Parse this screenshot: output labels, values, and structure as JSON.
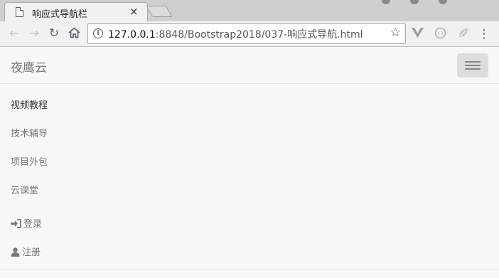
{
  "browser": {
    "tab_title": "响应式导航栏",
    "tab_close": "×",
    "url_host": "127.0.0.1",
    "url_rest": ":8848/Bootstrap2018/037-响应式导航.html"
  },
  "navbar": {
    "brand": "夜鹰云",
    "links": [
      {
        "label": "视频教程",
        "active": true
      },
      {
        "label": "技术辅导",
        "active": false
      },
      {
        "label": "项目外包",
        "active": false
      },
      {
        "label": "云课堂",
        "active": false
      }
    ],
    "right_links": [
      {
        "label": "登录",
        "icon": "log-in-icon"
      },
      {
        "label": "注册",
        "icon": "user-icon"
      }
    ]
  },
  "colors": {
    "navbar_bg": "#f8f8f8",
    "link": "#777777",
    "link_active": "#333333",
    "toggler_bg": "#dddddd"
  }
}
